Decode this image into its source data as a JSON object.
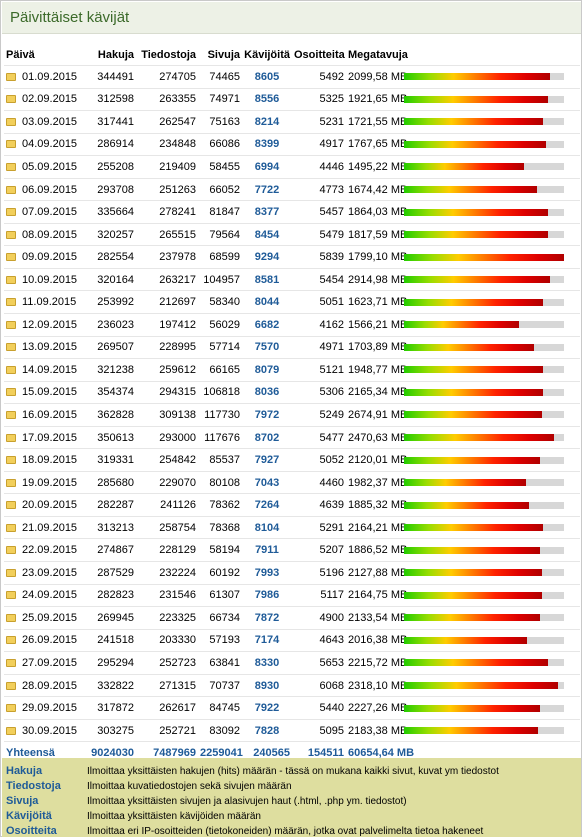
{
  "title": "Päivittäiset kävijät",
  "columns": [
    "Päivä",
    "Hakuja",
    "Tiedostoja",
    "Sivuja",
    "Kävijöitä",
    "Osoitteita",
    "Megatavuja"
  ],
  "rows": [
    {
      "date": "01.09.2015",
      "hits": "344491",
      "files": "274705",
      "pages": "74465",
      "visitors": "8605",
      "addresses": "5492",
      "mb": "2099,58 MB",
      "bar": 0.91
    },
    {
      "date": "02.09.2015",
      "hits": "312598",
      "files": "263355",
      "pages": "74971",
      "visitors": "8556",
      "addresses": "5325",
      "mb": "1921,65 MB",
      "bar": 0.9
    },
    {
      "date": "03.09.2015",
      "hits": "317441",
      "files": "262547",
      "pages": "75163",
      "visitors": "8214",
      "addresses": "5231",
      "mb": "1721,55 MB",
      "bar": 0.87
    },
    {
      "date": "04.09.2015",
      "hits": "286914",
      "files": "234848",
      "pages": "66086",
      "visitors": "8399",
      "addresses": "4917",
      "mb": "1767,65 MB",
      "bar": 0.89
    },
    {
      "date": "05.09.2015",
      "hits": "255208",
      "files": "219409",
      "pages": "58455",
      "visitors": "6994",
      "addresses": "4446",
      "mb": "1495,22 MB",
      "bar": 0.75
    },
    {
      "date": "06.09.2015",
      "hits": "293708",
      "files": "251263",
      "pages": "66052",
      "visitors": "7722",
      "addresses": "4773",
      "mb": "1674,42 MB",
      "bar": 0.83
    },
    {
      "date": "07.09.2015",
      "hits": "335664",
      "files": "278241",
      "pages": "81847",
      "visitors": "8377",
      "addresses": "5457",
      "mb": "1864,03 MB",
      "bar": 0.9
    },
    {
      "date": "08.09.2015",
      "hits": "320257",
      "files": "265515",
      "pages": "79564",
      "visitors": "8454",
      "addresses": "5479",
      "mb": "1817,59 MB",
      "bar": 0.9
    },
    {
      "date": "09.09.2015",
      "hits": "282554",
      "files": "237978",
      "pages": "68599",
      "visitors": "9294",
      "addresses": "5839",
      "mb": "1799,10 MB",
      "bar": 1.0
    },
    {
      "date": "10.09.2015",
      "hits": "320164",
      "files": "263217",
      "pages": "104957",
      "visitors": "8581",
      "addresses": "5454",
      "mb": "2914,98 MB",
      "bar": 0.91
    },
    {
      "date": "11.09.2015",
      "hits": "253992",
      "files": "212697",
      "pages": "58340",
      "visitors": "8044",
      "addresses": "5051",
      "mb": "1623,71 MB",
      "bar": 0.87
    },
    {
      "date": "12.09.2015",
      "hits": "236023",
      "files": "197412",
      "pages": "56029",
      "visitors": "6682",
      "addresses": "4162",
      "mb": "1566,21 MB",
      "bar": 0.72
    },
    {
      "date": "13.09.2015",
      "hits": "269507",
      "files": "228995",
      "pages": "57714",
      "visitors": "7570",
      "addresses": "4971",
      "mb": "1703,89 MB",
      "bar": 0.81
    },
    {
      "date": "14.09.2015",
      "hits": "321238",
      "files": "259612",
      "pages": "66165",
      "visitors": "8079",
      "addresses": "5121",
      "mb": "1948,77 MB",
      "bar": 0.87
    },
    {
      "date": "15.09.2015",
      "hits": "354374",
      "files": "294315",
      "pages": "106818",
      "visitors": "8036",
      "addresses": "5306",
      "mb": "2165,34 MB",
      "bar": 0.87
    },
    {
      "date": "16.09.2015",
      "hits": "362828",
      "files": "309138",
      "pages": "117730",
      "visitors": "7972",
      "addresses": "5249",
      "mb": "2674,91 MB",
      "bar": 0.86
    },
    {
      "date": "17.09.2015",
      "hits": "350613",
      "files": "293000",
      "pages": "117676",
      "visitors": "8702",
      "addresses": "5477",
      "mb": "2470,63 MB",
      "bar": 0.94
    },
    {
      "date": "18.09.2015",
      "hits": "319331",
      "files": "254842",
      "pages": "85537",
      "visitors": "7927",
      "addresses": "5052",
      "mb": "2120,01 MB",
      "bar": 0.85
    },
    {
      "date": "19.09.2015",
      "hits": "285680",
      "files": "229070",
      "pages": "80108",
      "visitors": "7043",
      "addresses": "4460",
      "mb": "1982,37 MB",
      "bar": 0.76
    },
    {
      "date": "20.09.2015",
      "hits": "282287",
      "files": "241126",
      "pages": "78362",
      "visitors": "7264",
      "addresses": "4639",
      "mb": "1885,32 MB",
      "bar": 0.78
    },
    {
      "date": "21.09.2015",
      "hits": "313213",
      "files": "258754",
      "pages": "78368",
      "visitors": "8104",
      "addresses": "5291",
      "mb": "2164,21 MB",
      "bar": 0.87
    },
    {
      "date": "22.09.2015",
      "hits": "274867",
      "files": "228129",
      "pages": "58194",
      "visitors": "7911",
      "addresses": "5207",
      "mb": "1886,52 MB",
      "bar": 0.85
    },
    {
      "date": "23.09.2015",
      "hits": "287529",
      "files": "232224",
      "pages": "60192",
      "visitors": "7993",
      "addresses": "5196",
      "mb": "2127,88 MB",
      "bar": 0.86
    },
    {
      "date": "24.09.2015",
      "hits": "282823",
      "files": "231546",
      "pages": "61307",
      "visitors": "7986",
      "addresses": "5117",
      "mb": "2164,75 MB",
      "bar": 0.86
    },
    {
      "date": "25.09.2015",
      "hits": "269945",
      "files": "223325",
      "pages": "66734",
      "visitors": "7872",
      "addresses": "4900",
      "mb": "2133,54 MB",
      "bar": 0.85
    },
    {
      "date": "26.09.2015",
      "hits": "241518",
      "files": "203330",
      "pages": "57193",
      "visitors": "7174",
      "addresses": "4643",
      "mb": "2016,38 MB",
      "bar": 0.77
    },
    {
      "date": "27.09.2015",
      "hits": "295294",
      "files": "252723",
      "pages": "63841",
      "visitors": "8330",
      "addresses": "5653",
      "mb": "2215,72 MB",
      "bar": 0.9
    },
    {
      "date": "28.09.2015",
      "hits": "332822",
      "files": "271315",
      "pages": "70737",
      "visitors": "8930",
      "addresses": "6068",
      "mb": "2318,10 MB",
      "bar": 0.96
    },
    {
      "date": "29.09.2015",
      "hits": "317872",
      "files": "262617",
      "pages": "84745",
      "visitors": "7922",
      "addresses": "5440",
      "mb": "2227,26 MB",
      "bar": 0.85
    },
    {
      "date": "30.09.2015",
      "hits": "303275",
      "files": "252721",
      "pages": "83092",
      "visitors": "7828",
      "addresses": "5095",
      "mb": "2183,38 MB",
      "bar": 0.84
    }
  ],
  "totals": {
    "label": "Yhteensä",
    "hits": "9024030",
    "files": "7487969",
    "pages": "2259041",
    "visitors": "240565",
    "addresses": "154511",
    "mb": "60654,64 MB"
  },
  "legend": [
    {
      "term": "Hakuja",
      "desc": "Ilmoittaa yksittäisten hakujen (hits) määrän - tässä on mukana kaikki sivut, kuvat ym tiedostot"
    },
    {
      "term": "Tiedostoja",
      "desc": "Ilmoittaa kuvatiedostojen sekä sivujen määrän"
    },
    {
      "term": "Sivuja",
      "desc": "Ilmoittaa yksittäisten sivujen ja alasivujen haut (.html, .php ym. tiedostot)"
    },
    {
      "term": "Kävijöitä",
      "desc": "Ilmoittaa yksittäisten kävijöiden määrän"
    },
    {
      "term": "Osoitteita",
      "desc": "Ilmoittaa eri IP-osoitteiden (tietokoneiden) määrän, jotka ovat palvelimelta tietoa hakeneet"
    }
  ],
  "colors": {
    "title": "#3c6a2a",
    "link": "#1f5b98",
    "legend_bg": "#dede9f"
  }
}
